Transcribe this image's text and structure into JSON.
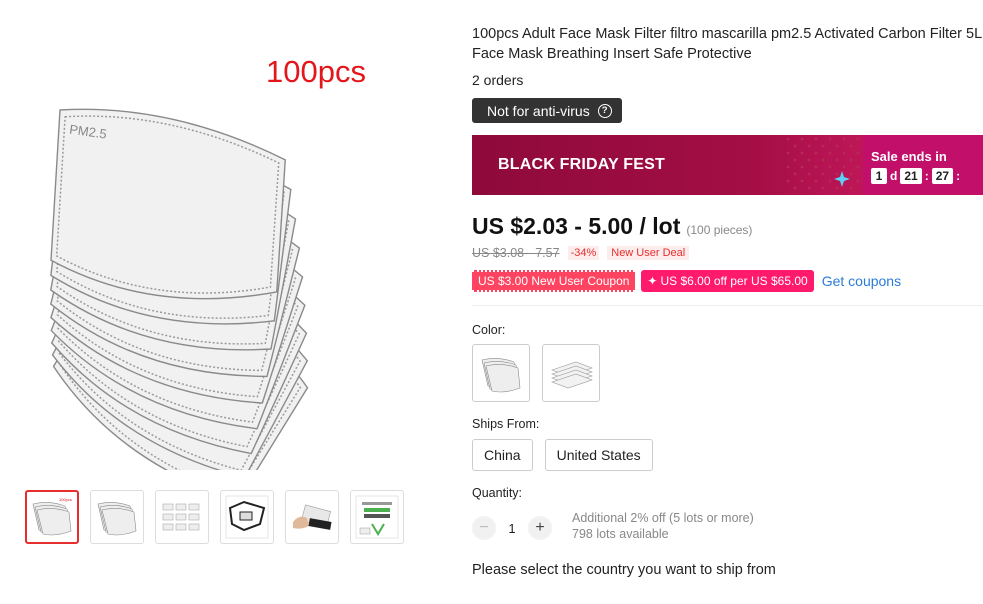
{
  "gallery": {
    "count_overlay": "100pcs",
    "thumbnails": [
      {
        "name": "thumb-1",
        "tag": "100pcs",
        "active": true
      },
      {
        "name": "thumb-2",
        "active": false
      },
      {
        "name": "thumb-3",
        "active": false
      },
      {
        "name": "thumb-4",
        "active": false
      },
      {
        "name": "thumb-5",
        "active": false
      },
      {
        "name": "thumb-6",
        "active": false
      }
    ],
    "filter_print": "PM2.5"
  },
  "product": {
    "title_line1": "100pcs Adult Face Mask Filter filtro mascarilla pm2.5 Activated Carbon Filter 5L",
    "title_line2": "Face Mask Breathing Insert Safe Protective",
    "orders": "2 orders",
    "notice": "Not for anti-virus",
    "notice_icon": "?"
  },
  "banner": {
    "title": "BLACK FRIDAY FEST",
    "sale_label": "Sale ends in",
    "days": "1",
    "days_unit": "d",
    "hours": "21",
    "minutes": "27",
    "sep": ":",
    "colors": {
      "bg": "#a40e44",
      "accent": "#c10f6a"
    }
  },
  "price": {
    "current": "US $2.03 - 5.00 / lot",
    "pieces": "(100 pieces)",
    "original": "US $3.08 - 7.57",
    "discount": "-34%",
    "deal": "New User Deal"
  },
  "coupons": {
    "new_user": "US $3.00 New User Coupon",
    "store_prefix": "✦",
    "store": "US $6.00 off per US $65.00",
    "link": "Get coupons"
  },
  "color": {
    "label": "Color:"
  },
  "shipping": {
    "label": "Ships From:",
    "options": [
      "China",
      "United States"
    ]
  },
  "quantity": {
    "label": "Quantity:",
    "value": "1",
    "minus": "−",
    "plus": "+",
    "note1": "Additional 2% off (5 lots or more)",
    "note2": "798 lots available"
  },
  "ship_note": "Please select the country you want to ship from"
}
